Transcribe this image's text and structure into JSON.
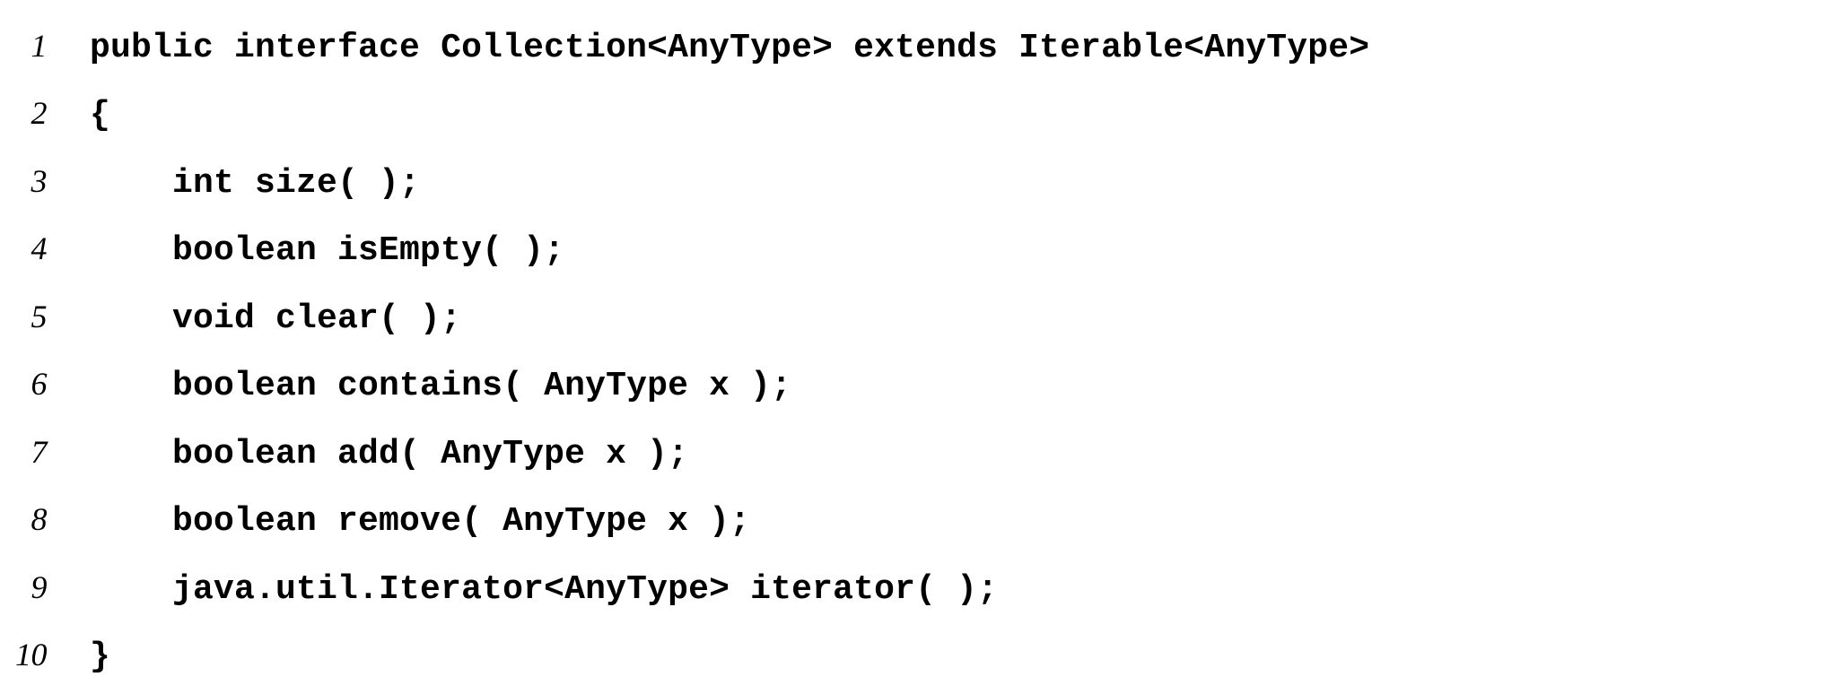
{
  "code": {
    "lines": [
      {
        "num": "1",
        "text": "public interface Collection<AnyType> extends Iterable<AnyType>"
      },
      {
        "num": "2",
        "text": "{"
      },
      {
        "num": "3",
        "text": "    int size( );"
      },
      {
        "num": "4",
        "text": "    boolean isEmpty( );"
      },
      {
        "num": "5",
        "text": "    void clear( );"
      },
      {
        "num": "6",
        "text": "    boolean contains( AnyType x );"
      },
      {
        "num": "7",
        "text": "    boolean add( AnyType x );"
      },
      {
        "num": "8",
        "text": "    boolean remove( AnyType x );"
      },
      {
        "num": "9",
        "text": "    java.util.Iterator<AnyType> iterator( );"
      },
      {
        "num": "10",
        "text": "}"
      }
    ]
  }
}
